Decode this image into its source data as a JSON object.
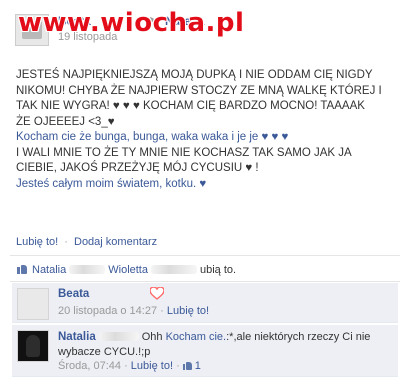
{
  "watermark": {
    "text": "www.wiocha.pl"
  },
  "post": {
    "author": "Beata",
    "arrow": "▸",
    "target": "Natalia",
    "date": "19 listopada",
    "body": {
      "line1": "JESTEŚ NAJPIĘKNIEJSZĄ MOJĄ DUPKĄ I NIE ODDAM CIĘ NIGDY",
      "line2": "NIKOMU! CHYBA ŻE NAJPIERW STOCZY ZE MNĄ WALKĘ KTÓREJ I",
      "line3": "TAK NIE WYGRA! ♥ ♥ ♥ KOCHAM CIĘ BARDZO MOCNO! TAAAAK",
      "line4": "ŻE OJEEEEJ <3_♥",
      "line5": "Kocham cie że bunga, bunga, waka waka i je je ♥ ♥ ♥",
      "line6": "I WALI MNIE TO ŻE TY MNIE NIE KOCHASZ TAK SAMO JAK JA",
      "line7": "CIEBIE, JAKOŚ PRZEŻYJĘ MÓJ CYCUSIU ♥ !",
      "line8": "Jesteś całym moim światem, kotku. ♥"
    },
    "actions": {
      "like": "Lubię to!",
      "separator": "·",
      "comment": "Dodaj komentarz"
    }
  },
  "likes": {
    "name1": "Natalia",
    "name2": "Wioletta",
    "suffix": "ubią to."
  },
  "comments": [
    {
      "author": "Beata",
      "text": "",
      "date": "20 listopada o 14:27",
      "separator": "·",
      "like": "Lubię to!"
    },
    {
      "author": "Natalia",
      "text_prefix": "Ohh ",
      "text_blue": "Kocham cie.",
      "text_rest": ":*,ale niektórych rzeczy Ci nie",
      "text_line2": "wybacze CYCU.!;p",
      "date": "Środa, 07:44",
      "separator": "·",
      "like": "Lubię to!",
      "like_count_sep": "·",
      "like_count": "1"
    }
  ],
  "colors": {
    "link": "#3b5998",
    "comment_bg": "#edeff4",
    "watermark": "#e20d18",
    "heart": "#ff6a6a"
  }
}
